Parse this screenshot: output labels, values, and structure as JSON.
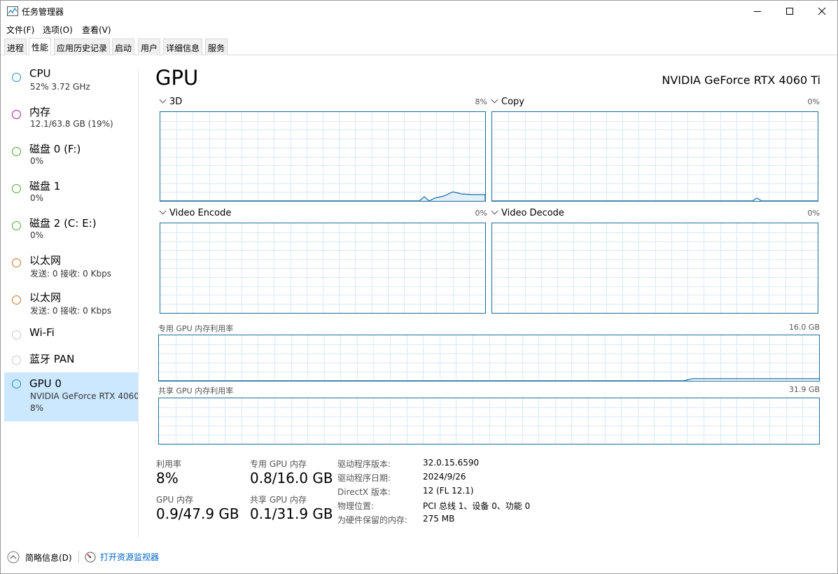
{
  "window": {
    "title": "任务管理器",
    "minimize_icon": "minimize-icon",
    "maximize_icon": "maximize-icon",
    "close_icon": "close-icon"
  },
  "menu": {
    "file": "文件(F)",
    "options": "选项(O)",
    "view": "查看(V)"
  },
  "tabs": [
    "进程",
    "性能",
    "应用历史记录",
    "启动",
    "用户",
    "详细信息",
    "服务"
  ],
  "active_tab": "性能",
  "sidebar": [
    {
      "name": "CPU",
      "sub": "52%  3.72 GHz",
      "color": "#1e90c8"
    },
    {
      "name": "内存",
      "sub": "12.1/63.8 GB (19%)",
      "color": "#a31a9e"
    },
    {
      "name": "磁盘 0 (F:)",
      "sub": "0%",
      "color": "#4ca82f"
    },
    {
      "name": "磁盘 1",
      "sub": "0%",
      "color": "#4ca82f"
    },
    {
      "name": "磁盘 2 (C: E:)",
      "sub": "0%",
      "color": "#4ca82f"
    },
    {
      "name": "以太网",
      "sub": "发送: 0 接收: 0 Kbps",
      "color": "#c8741e"
    },
    {
      "name": "以太网",
      "sub": "发送: 0 接收: 0 Kbps",
      "color": "#c8741e"
    },
    {
      "name": "Wi-Fi",
      "sub": "",
      "color": "#c8c8c8"
    },
    {
      "name": "蓝牙 PAN",
      "sub": "",
      "color": "#c8c8c8"
    },
    {
      "name": "GPU 0",
      "sub": "NVIDIA GeForce RTX 4060",
      "sub2": "8%",
      "color": "#1e90c8",
      "selected": true
    }
  ],
  "main": {
    "title": "GPU",
    "model": "NVIDIA GeForce RTX 4060 Ti",
    "engines": [
      {
        "label": "3D",
        "pct": "8%"
      },
      {
        "label": "Copy",
        "pct": "0%"
      },
      {
        "label": "Video Encode",
        "pct": "0%"
      },
      {
        "label": "Video Decode",
        "pct": "0%"
      }
    ],
    "dedicated_label": "专用 GPU 内存利用率",
    "dedicated_max": "16.0 GB",
    "shared_label": "共享 GPU 内存利用率",
    "shared_max": "31.9 GB"
  },
  "stats": {
    "util_label": "利用率",
    "util_value": "8%",
    "gpu_mem_label": "GPU 内存",
    "gpu_mem_value": "0.9/47.9 GB",
    "ded_label": "专用 GPU 内存",
    "ded_value": "0.8/16.0 GB",
    "shared_label": "共享 GPU 内存",
    "shared_value": "0.1/31.9 GB"
  },
  "info": [
    {
      "label": "驱动程序版本:",
      "value": "32.0.15.6590"
    },
    {
      "label": "驱动程序日期:",
      "value": "2024/9/26"
    },
    {
      "label": "DirectX 版本:",
      "value": "12 (FL 12.1)"
    },
    {
      "label": "物理位置:",
      "value": "PCI 总线 1、设备 0、功能 0"
    },
    {
      "label": "为硬件保留的内存:",
      "value": "275 MB"
    }
  ],
  "footer": {
    "summary": "简略信息(D)",
    "monitor_link": "打开资源监视器"
  },
  "colors": {
    "accent": "#1b6d9e",
    "selected_bg": "#cce8ff",
    "link": "#0066cc"
  }
}
